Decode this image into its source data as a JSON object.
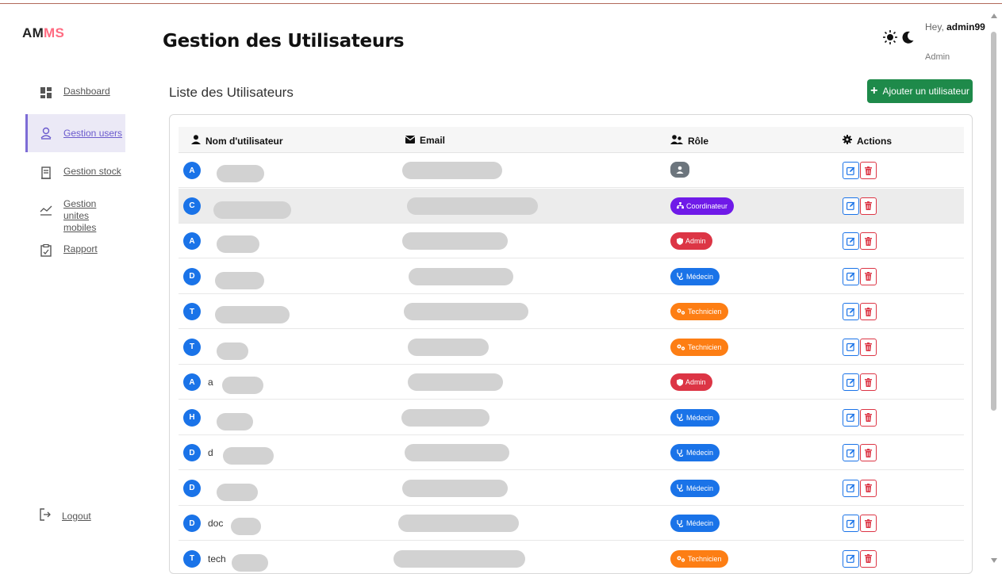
{
  "brand": {
    "part1": "AM",
    "part2": "MS"
  },
  "sidebar": {
    "items": [
      {
        "label": "Dashboard",
        "icon": "dashboard-grid-icon"
      },
      {
        "label": "Gestion users",
        "icon": "user-icon",
        "active": true
      },
      {
        "label": "Gestion stock",
        "icon": "stock-icon"
      },
      {
        "label": "Gestion unites mobiles",
        "icon": "analytics-icon"
      },
      {
        "label": "Rapport",
        "icon": "clipboard-icon"
      }
    ],
    "logout": "Logout"
  },
  "header": {
    "title": "Gestion des Utilisateurs",
    "greeting": "Hey, ",
    "username": "admin99",
    "user_role": "Admin"
  },
  "main": {
    "section_title": "Liste des Utilisateurs",
    "add_button": "Ajouter un utilisateur",
    "columns": [
      "Nom d'utilisateur",
      "Email",
      "Rôle",
      "Actions"
    ],
    "rows": [
      {
        "initial": "A",
        "name_prefix": "",
        "role": "",
        "role_type": "none"
      },
      {
        "initial": "C",
        "name_prefix": "",
        "role": "Coordinateur",
        "role_type": "coordinateur"
      },
      {
        "initial": "A",
        "name_prefix": "",
        "role": "Admin",
        "role_type": "admin"
      },
      {
        "initial": "D",
        "name_prefix": "",
        "role": "Médecin",
        "role_type": "medecin"
      },
      {
        "initial": "T",
        "name_prefix": "",
        "role": "Technicien",
        "role_type": "technicien"
      },
      {
        "initial": "T",
        "name_prefix": "",
        "role": "Technicien",
        "role_type": "technicien"
      },
      {
        "initial": "A",
        "name_prefix": "a",
        "role": "Admin",
        "role_type": "admin"
      },
      {
        "initial": "H",
        "name_prefix": "",
        "role": "Médecin",
        "role_type": "medecin"
      },
      {
        "initial": "D",
        "name_prefix": "d",
        "role": "Médecin",
        "role_type": "medecin"
      },
      {
        "initial": "D",
        "name_prefix": "",
        "role": "Médecin",
        "role_type": "medecin"
      },
      {
        "initial": "D",
        "name_prefix": "doc",
        "role": "Médecin",
        "role_type": "medecin"
      },
      {
        "initial": "T",
        "name_prefix": "tech",
        "role": "Technicien",
        "role_type": "technicien"
      }
    ]
  },
  "colors": {
    "accent": "#7d6cd6",
    "add_button": "#1e8a4a",
    "admin": "#dc3545",
    "medecin": "#1a73e8",
    "technicien": "#fd7e14",
    "coordinateur": "#6f1ae8"
  }
}
